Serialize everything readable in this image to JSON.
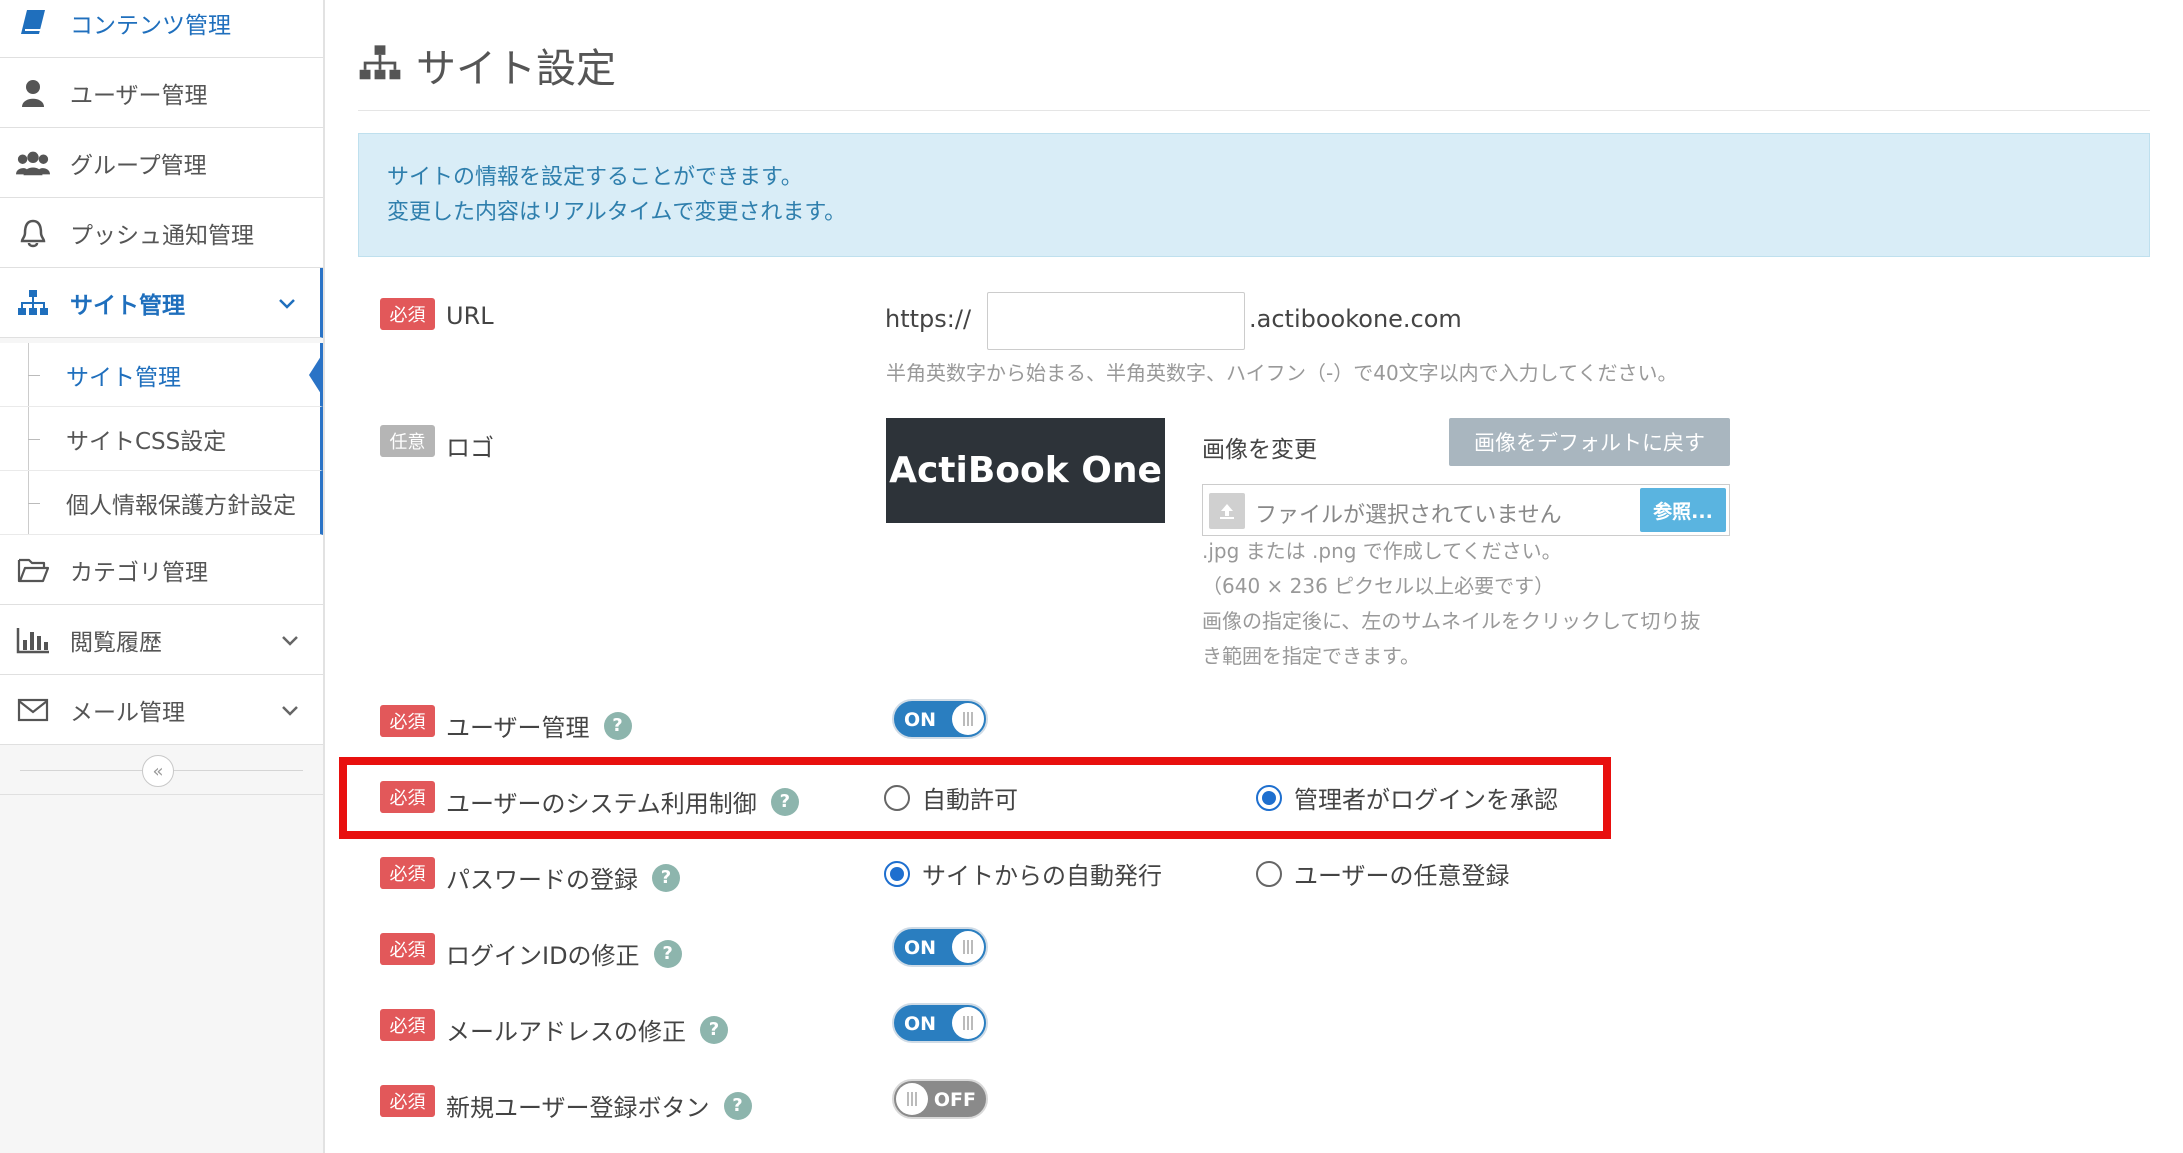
{
  "sidebar": {
    "items": [
      {
        "label": "コンテンツ管理",
        "icon": "book-icon"
      },
      {
        "label": "ユーザー管理",
        "icon": "user-icon"
      },
      {
        "label": "グループ管理",
        "icon": "users-icon"
      },
      {
        "label": "プッシュ通知管理",
        "icon": "bell-icon"
      },
      {
        "label": "サイト管理",
        "icon": "sitemap-icon"
      },
      {
        "label": "カテゴリ管理",
        "icon": "folder-icon"
      },
      {
        "label": "閲覧履歴",
        "icon": "bar-chart-icon"
      },
      {
        "label": "メール管理",
        "icon": "envelope-icon"
      }
    ],
    "sub_items": [
      {
        "label": "サイト管理"
      },
      {
        "label": "サイトCSS設定"
      },
      {
        "label": "個人情報保護方針設定"
      }
    ],
    "collapse_glyph": "«"
  },
  "page": {
    "title": "サイト設定",
    "info_line1": "サイトの情報を設定することができます。",
    "info_line2": "変更した内容はリアルタイムで変更されます。"
  },
  "badges": {
    "required": "必須",
    "optional": "任意"
  },
  "qmark": "?",
  "fields": {
    "url": {
      "label": "URL",
      "prefix": "https://",
      "value": "",
      "suffix": ".actibookone.com",
      "help": "半角英数字から始まる、半角英数字、ハイフン（-）で40文字以内で入力してください。"
    },
    "logo": {
      "label": "ロゴ",
      "logo_text": "ActiBook One",
      "change_label": "画像を変更",
      "default_button": "画像をデフォルトに戻す",
      "file_placeholder": "ファイルが選択されていません",
      "browse_button": "参照...",
      "help1": ".jpg または .png で作成してください。",
      "help2": "（640 × 236 ピクセル以上必要です）",
      "help3": "画像の指定後に、左のサムネイルをクリックして切り抜",
      "help4": "き範囲を指定できます。"
    },
    "user_mgmt": {
      "label": "ユーザー管理",
      "toggle": "ON"
    },
    "system_control": {
      "label": "ユーザーのシステム利用制御",
      "opt1": "自動許可",
      "opt2": "管理者がログインを承認",
      "selected": "opt2"
    },
    "password": {
      "label": "パスワードの登録",
      "opt1": "サイトからの自動発行",
      "opt2": "ユーザーの任意登録",
      "selected": "opt1"
    },
    "login_id": {
      "label": "ログインIDの修正",
      "toggle": "ON"
    },
    "email": {
      "label": "メールアドレスの修正",
      "toggle": "ON"
    },
    "new_user_btn": {
      "label": "新規ユーザー登録ボタン",
      "toggle": "OFF"
    }
  },
  "colors": {
    "accent": "#2a73c6",
    "required": "#e2585a",
    "highlight": "#e8100e",
    "info_bg": "#d9edf7"
  }
}
